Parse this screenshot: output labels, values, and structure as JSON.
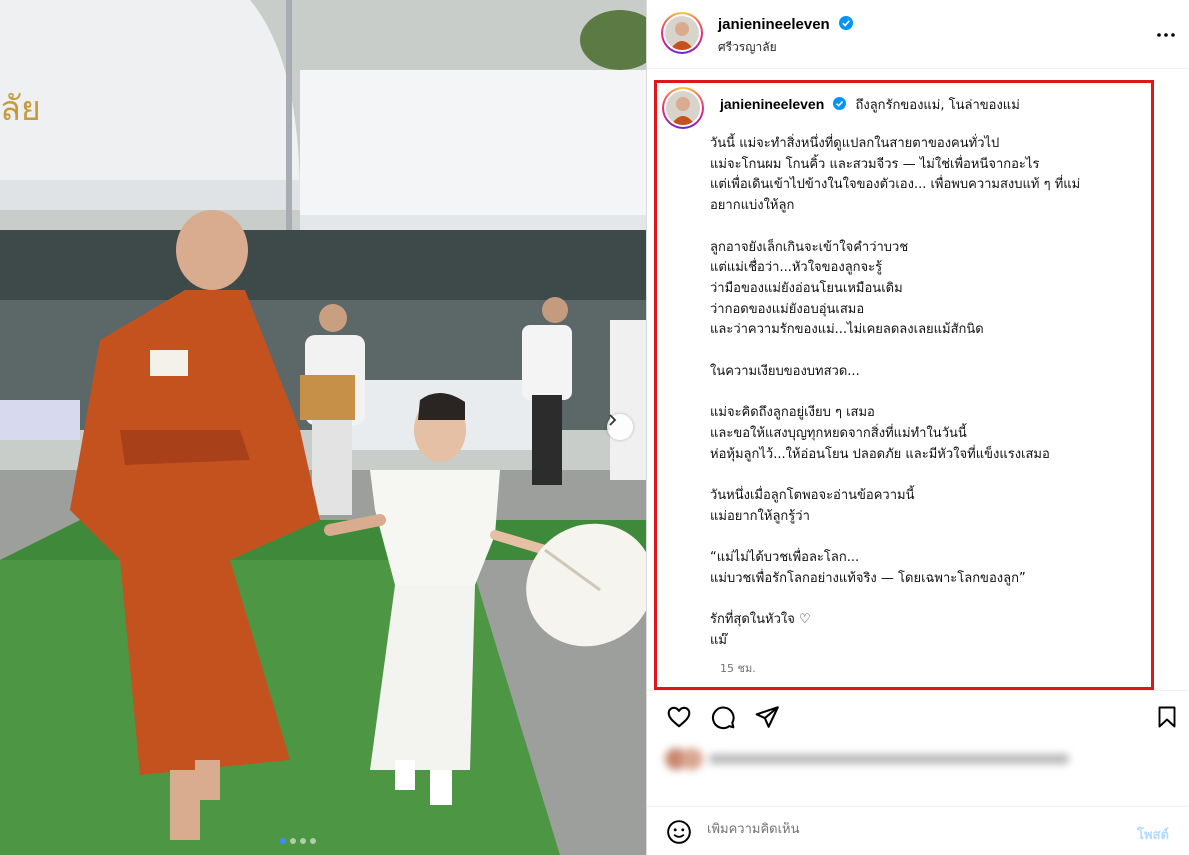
{
  "post": {
    "username": "janienineeleven",
    "location": "ศรีวรญาลัย",
    "carousel": {
      "total_slides": 4,
      "active_slide": 1
    }
  },
  "caption": {
    "username": "janienineeleven",
    "title": "ถึงลูกรักของแม่, โนล่าของแม่",
    "paragraphs": [
      [
        "วันนี้ แม่จะทำสิ่งหนึ่งที่ดูแปลกในสายตาของคนทั่วไป",
        "แม่จะโกนผม โกนคิ้ว และสวมจีวร — ไม่ใช่เพื่อหนีจากอะไร",
        "แต่เพื่อเดินเข้าไปข้างในใจของตัวเอง... เพื่อพบความสงบแท้ ๆ ที่แม่",
        "อยากแบ่งให้ลูก"
      ],
      [
        "ลูกอาจยังเล็กเกินจะเข้าใจคำว่าบวช",
        "แต่แม่เชื่อว่า...หัวใจของลูกจะรู้",
        "ว่ามือของแม่ยังอ่อนโยนเหมือนเดิม",
        "ว่ากอดของแม่ยังอบอุ่นเสมอ",
        "และว่าความรักของแม่...ไม่เคยลดลงเลยแม้สักนิด"
      ],
      [
        "ในความเงียบของบทสวด..."
      ],
      [
        "แม่จะคิดถึงลูกอยู่เงียบ ๆ เสมอ",
        "และขอให้แสงบุญทุกหยดจากสิ่งที่แม่ทำในวันนี้",
        "ห่อหุ้มลูกไว้...ให้อ่อนโยน ปลอดภัย และมีหัวใจที่แข็งแรงเสมอ"
      ],
      [
        "วันหนึ่งเมื่อลูกโตพอจะอ่านข้อความนี้",
        "แม่อยากให้ลูกรู้ว่า"
      ],
      [
        "“แม่ไม่ได้บวชเพื่อละโลก...",
        "แม่บวชเพื่อรักโลกอย่างแท้จริง — โดยเฉพาะโลกของลูก”"
      ],
      [
        "รักที่สุดในหัวใจ ♡",
        "แม๊"
      ]
    ],
    "time_ago": "15 ชม."
  },
  "actions": {
    "like_icon": "heart-icon",
    "comment_icon": "comment-icon",
    "share_icon": "send-icon",
    "save_icon": "bookmark-icon"
  },
  "comment": {
    "placeholder": "เพิ่มความคิดเห็น",
    "post_label": "โพสต์"
  },
  "colors": {
    "highlight_border": "#e0161b",
    "verified_blue": "#0095f6",
    "post_button_disabled": "#b3dbff",
    "robe": "#c4521f",
    "grass": "#3f8a3a"
  }
}
